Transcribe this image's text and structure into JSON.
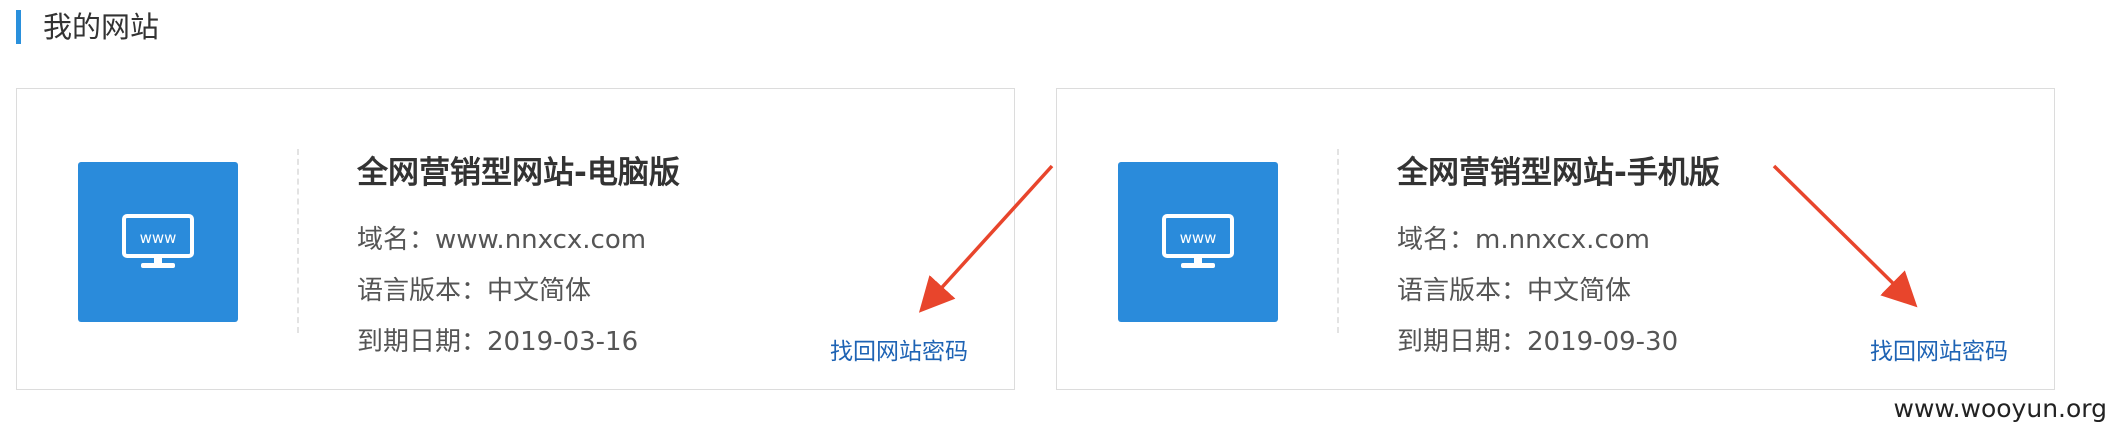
{
  "section": {
    "title": "我的网站"
  },
  "sites": [
    {
      "title": "全网营销型网站-电脑版",
      "icon": "www-monitor-icon",
      "domain_label": "域名：",
      "domain": "www.nnxcx.com",
      "language_label": "语言版本：",
      "language": "中文简体",
      "expiry_label": "到期日期：",
      "expiry": "2019-03-16",
      "recover_link": "找回网站密码",
      "icon_text": "www"
    },
    {
      "title": "全网营销型网站-手机版",
      "icon": "www-monitor-icon",
      "domain_label": "域名：",
      "domain": "m.nnxcx.com",
      "language_label": "语言版本：",
      "language": "中文简体",
      "expiry_label": "到期日期：",
      "expiry": "2019-09-30",
      "recover_link": "找回网站密码",
      "icon_text": "www"
    }
  ],
  "watermark": "www.wooyun.org",
  "colors": {
    "accent": "#2a8bdb",
    "link": "#1e63b4",
    "annotation_arrow": "#e8452c"
  }
}
